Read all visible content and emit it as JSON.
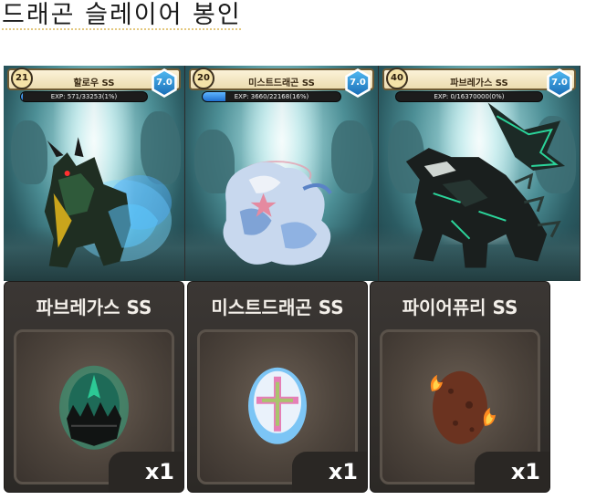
{
  "page": {
    "title": "드래곤 슬레이어 봉인"
  },
  "dragons": [
    {
      "level": "21",
      "name": "할로우 SS",
      "grade": "7.0",
      "exp_text": "EXP: 571/33253(1%)",
      "exp_progress": 0.017
    },
    {
      "level": "20",
      "name": "미스트드래곤 SS",
      "grade": "7.0",
      "exp_text": "EXP: 3660/22168(16%)",
      "exp_progress": 0.165
    },
    {
      "level": "40",
      "name": "파브레가스 SS",
      "grade": "7.0",
      "exp_text": "EXP: 0/16370000(0%)",
      "exp_progress": 0.0
    }
  ],
  "eggs": [
    {
      "name": "파브레가스 SS",
      "quantity": "x1",
      "icon": "dark-spiked-egg-icon"
    },
    {
      "name": "미스트드래곤 SS",
      "quantity": "x1",
      "icon": "pink-cross-egg-icon"
    },
    {
      "name": "파이어퓨리 SS",
      "quantity": "x1",
      "icon": "fire-egg-icon"
    }
  ],
  "colors": {
    "grade_badge": "#1b6fb8",
    "exp_fill": "#1f6fd0",
    "card_background": "#4c8e95",
    "egg_panel": "#3b3734"
  }
}
